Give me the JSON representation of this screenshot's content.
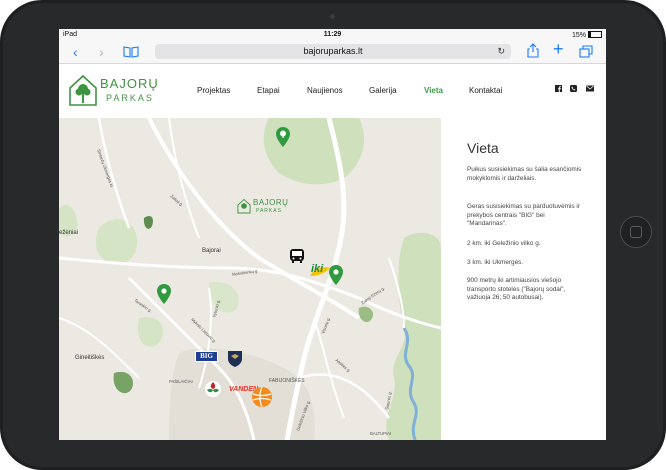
{
  "status_bar": {
    "device": "iPad",
    "time": "11:29",
    "battery": "15%"
  },
  "browser": {
    "url": "bajoruparkas.lt"
  },
  "header": {
    "logo": {
      "line1": "BAJORŲ",
      "line2": "PARKAS"
    },
    "menu": [
      {
        "label": "Projektas"
      },
      {
        "label": "Etapai"
      },
      {
        "label": "Naujienos"
      },
      {
        "label": "Galerija"
      },
      {
        "label": "Vieta",
        "active": true
      },
      {
        "label": "Kontaktai"
      }
    ],
    "social": [
      "facebook-icon",
      "viber-icon",
      "mail-icon"
    ]
  },
  "map": {
    "places": {
      "village_bajorai": "Bajorai",
      "zeleziniai": "ežėniai",
      "gineitiskes": "Gineitiškės",
      "pasilaiciai": "PAŠILAIČIAI",
      "fabijoniskes": "FABIJONIŠKĖS",
      "baltupiai": "BALTUPIAI"
    },
    "streets": {
      "sintautu": "Sintautų Ukmergės kl.",
      "zalioji": "Žalioji g.",
      "mokslininku": "Mokslininkų g.",
      "vilnius_road": "Geležinio Vilko g.",
      "juosta": "Zalioji Ežerų g.",
      "taraskio": "Taraskio g.",
      "vyteniu": "Vytenio g.",
      "molino": "Mykolo Lietuvio g.",
      "ateities": "Ateities g.",
      "visoriu": "Visorių g.",
      "sirvintu": "Šiaurės g."
    },
    "logos": {
      "big": "BIG",
      "iki": "iki",
      "vandens": "VANDEN"
    }
  },
  "panel": {
    "title": "Vieta",
    "paragraphs": [
      "Puikus susisiekimas su šalia esančiomis mokyklomis ir darželiais.",
      "Geras susisiekimas su parduotuvėmis ir prekybos centrais \"BIG\" bei \"Mandarinas\".",
      "2 km. iki Geležinio vilko g.",
      "3 km. iki Ukmergės.",
      "900 metrų iki artimiausios viešojo transporto stotelės (\"Bajorų sodai\", važiuoja 26; 50 autobusai)."
    ]
  },
  "colors": {
    "brand_green": "#3f9442",
    "pin_green": "#2f9a3e",
    "link_blue": "#1a7cf4"
  }
}
